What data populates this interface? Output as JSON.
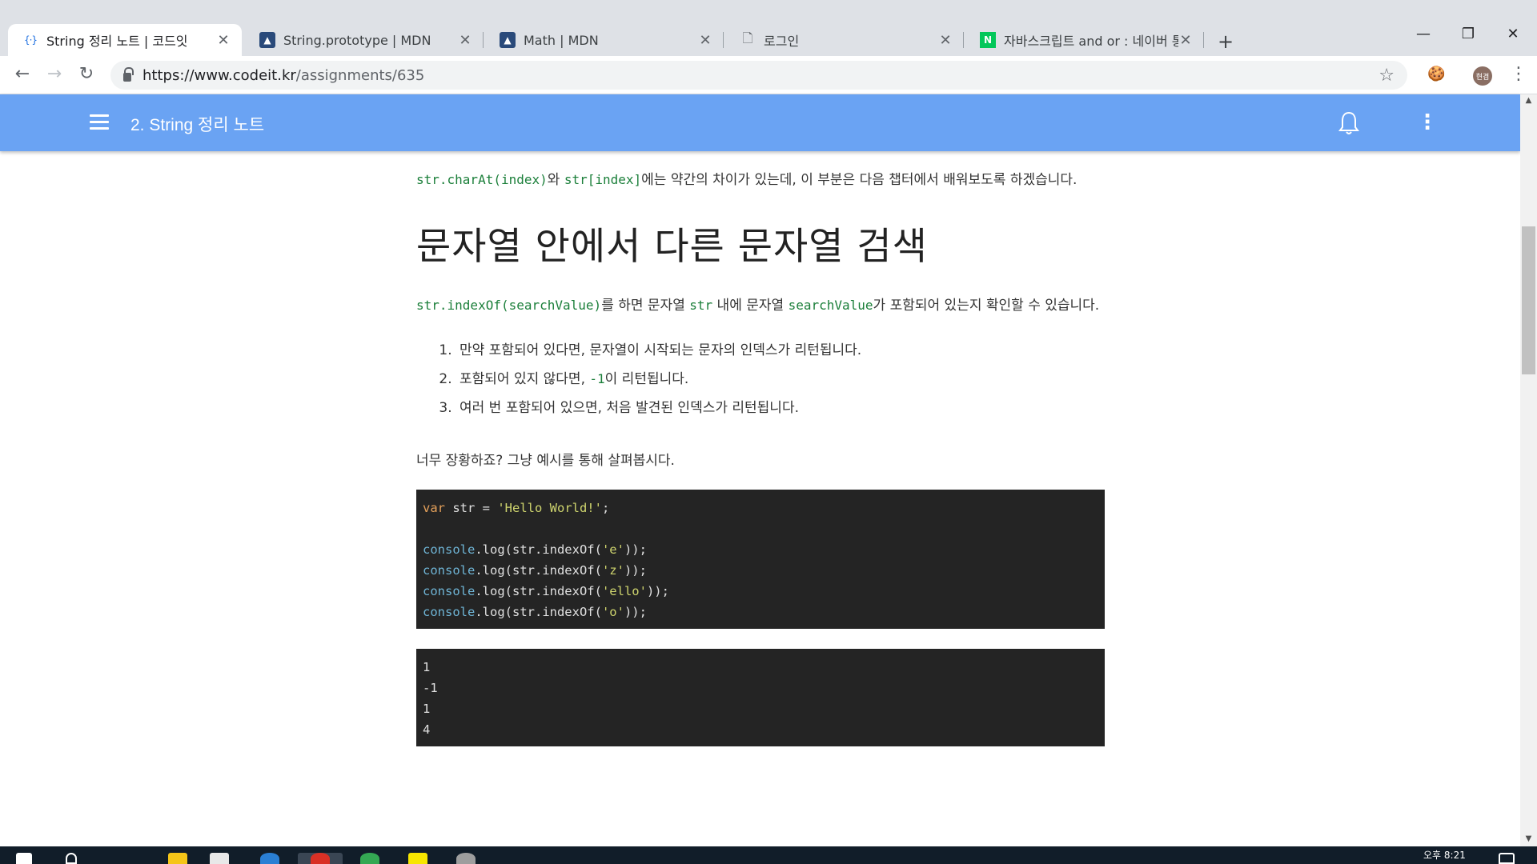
{
  "browser": {
    "tabs": [
      {
        "title": "String 정리 노트 | 코드잇",
        "favicon": "codeit-braces-icon",
        "active": true
      },
      {
        "title": "String.prototype | MDN",
        "favicon": "mdn-dino-icon",
        "active": false
      },
      {
        "title": "Math | MDN",
        "favicon": "mdn-dino-icon",
        "active": false
      },
      {
        "title": "로그인",
        "favicon": "page-icon",
        "active": false
      },
      {
        "title": "자바스크립트 and or : 네이버 통",
        "favicon": "naver-n-icon",
        "active": false
      }
    ],
    "url_main": "https://www.codeit.kr",
    "url_path": "/assignments/635",
    "profile_initials": "현겸"
  },
  "app": {
    "title": "2. String 정리 노트"
  },
  "content": {
    "intro": {
      "code1": "str.charAt(index)",
      "text1": "와 ",
      "code2": "str[index]",
      "text2": "에는 약간의 차이가 있는데, 이 부분은 다음 챕터에서 배워보도록 하겠습니다."
    },
    "heading": "문자열 안에서 다른 문자열 검색",
    "para": {
      "code1": "str.indexOf(searchValue)",
      "text1": "를 하면 문자열 ",
      "code2": "str",
      "text2": " 내에 문자열 ",
      "code3": "searchValue",
      "text3": "가 포함되어 있는지 확인할 수 있습니다."
    },
    "list": [
      {
        "text": "만약 포함되어 있다면, 문자열이 시작되는 문자의 인덱스가 리턴됩니다."
      },
      {
        "text_before": "포함되어 있지 않다면, ",
        "code": "-1",
        "text_after": "이 리턴됩니다."
      },
      {
        "text": "여러 번 포함되어 있으면, 처음 발견된 인덱스가 리턴됩니다."
      }
    ],
    "example_intro": "너무 장황하죠? 그냥 예시를 통해 살펴봅시다.",
    "code": {
      "decl_kw": "var",
      "decl_rest": " str = ",
      "decl_str": "'Hello World!'",
      "decl_end": ";",
      "obj": "console",
      "call_prefix": ".log(str.indexOf(",
      "call_suffix": "));",
      "args": [
        "'e'",
        "'z'",
        "'ello'",
        "'o'"
      ]
    },
    "output": [
      "1",
      "-1",
      "1",
      "4"
    ]
  },
  "taskbar": {
    "time_prefix": "오후 8:21"
  },
  "colors": {
    "header_blue": "#6aa3f3",
    "inline_code_green": "#1b7f3a",
    "code_bg": "#242424"
  }
}
